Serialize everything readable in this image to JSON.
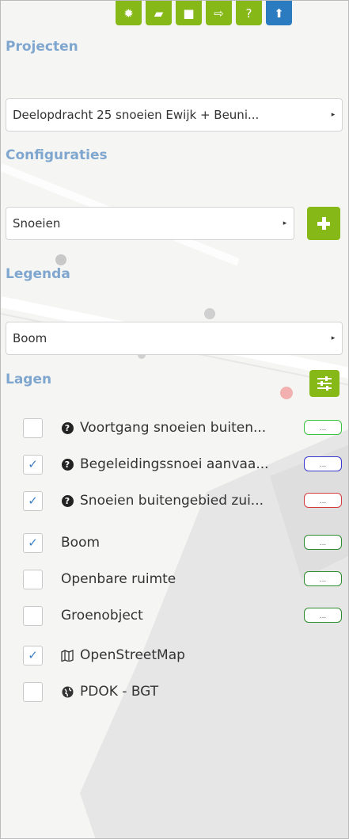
{
  "toolbar": {
    "buttons": [
      {
        "icon": "gear-icon",
        "glyph": "✹",
        "color": "#86b817"
      },
      {
        "icon": "folder-open-icon",
        "glyph": "▰",
        "color": "#86b817"
      },
      {
        "icon": "lock-icon",
        "glyph": "■",
        "color": "#86b817"
      },
      {
        "icon": "export-icon",
        "glyph": "⇨",
        "color": "#86b817"
      },
      {
        "icon": "help-icon",
        "glyph": "?",
        "color": "#86b817"
      },
      {
        "icon": "upload-icon",
        "glyph": "⬆",
        "color": "#2b7bc0"
      }
    ]
  },
  "projects": {
    "title": "Projecten",
    "selected": "Deelopdracht 25 snoeien Ewijk + Beuni...",
    "caret": "▸"
  },
  "configurations": {
    "title": "Configuraties",
    "selected": "Snoeien",
    "caret": "▸",
    "add_label": "+"
  },
  "legend": {
    "title": "Legenda",
    "selected": "Boom",
    "caret": "▸"
  },
  "layers": {
    "title": "Lagen",
    "items": [
      {
        "label": "Voortgang snoeien buiten...",
        "checked": false,
        "icon": "question-circle-icon",
        "swatch": "#3cc23c",
        "swatch_text": "..."
      },
      {
        "label": "Begeleidingssnoei aanvaa...",
        "checked": true,
        "icon": "question-circle-icon",
        "swatch": "#3a3acf",
        "swatch_text": "..."
      },
      {
        "label": "Snoeien buitengebied zui...",
        "checked": true,
        "icon": "question-circle-icon",
        "swatch": "#d33c3c",
        "swatch_text": "..."
      },
      {
        "label": "Boom",
        "checked": true,
        "icon": "",
        "swatch": "#2e8b2e",
        "swatch_text": "..."
      },
      {
        "label": "Openbare ruimte",
        "checked": false,
        "icon": "",
        "swatch": "#2e8b2e",
        "swatch_text": "..."
      },
      {
        "label": "Groenobject",
        "checked": false,
        "icon": "",
        "swatch": "#2e8b2e",
        "swatch_text": "..."
      },
      {
        "label": "OpenStreetMap",
        "checked": true,
        "icon": "map-icon",
        "swatch": "",
        "swatch_text": ""
      },
      {
        "label": "PDOK - BGT",
        "checked": false,
        "icon": "globe-icon",
        "swatch": "",
        "swatch_text": ""
      }
    ],
    "check_glyph": "✓"
  }
}
